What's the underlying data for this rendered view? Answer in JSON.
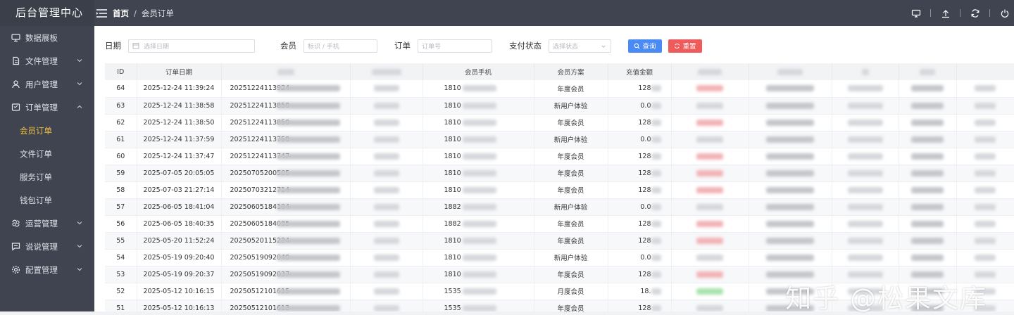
{
  "app": {
    "title": "后台管理中心"
  },
  "sidebar": {
    "items": [
      {
        "label": "数据展板",
        "icon": "monitor-icon"
      },
      {
        "label": "文件管理",
        "icon": "file-icon"
      },
      {
        "label": "用户管理",
        "icon": "user-icon"
      },
      {
        "label": "订单管理",
        "icon": "order-icon"
      },
      {
        "label": "运营管理",
        "icon": "operation-icon"
      },
      {
        "label": "说说管理",
        "icon": "chat-icon"
      },
      {
        "label": "配置管理",
        "icon": "gear-icon"
      }
    ],
    "submenu": [
      {
        "label": "会员订单",
        "active": true
      },
      {
        "label": "文件订单",
        "active": false
      },
      {
        "label": "服务订单",
        "active": false
      },
      {
        "label": "钱包订单",
        "active": false
      }
    ]
  },
  "header": {
    "breadcrumb": {
      "home": "首页",
      "separator": "/",
      "current": "会员订单"
    }
  },
  "filters": {
    "date": {
      "label": "日期",
      "placeholder": "选择日期"
    },
    "member": {
      "label": "会员",
      "placeholder": "标识 / 手机"
    },
    "order": {
      "label": "订单",
      "placeholder": "订单号"
    },
    "pay_status": {
      "label": "支付状态",
      "placeholder": "选择状态"
    },
    "search_label": "查询",
    "reset_label": "重置"
  },
  "table": {
    "headers": [
      "ID",
      "订单日期",
      "",
      "",
      "会员手机",
      "会员方案",
      "充值金额"
    ],
    "rows": [
      {
        "id": "64",
        "date": "2025-12-24 11:39:24",
        "order_no": "20251224113924",
        "phone": "1810",
        "plan": "年度会员",
        "amount": "128"
      },
      {
        "id": "63",
        "date": "2025-12-24 11:38:58",
        "order_no": "20251224113858",
        "phone": "1810",
        "plan": "新用户体验",
        "amount": "0.0"
      },
      {
        "id": "62",
        "date": "2025-12-24 11:38:50",
        "order_no": "20251224113850",
        "phone": "1810",
        "plan": "年度会员",
        "amount": "128"
      },
      {
        "id": "61",
        "date": "2025-12-24 11:37:59",
        "order_no": "20251224113759",
        "phone": "1810",
        "plan": "新用户体验",
        "amount": "0.0"
      },
      {
        "id": "60",
        "date": "2025-12-24 11:37:47",
        "order_no": "20251224113747",
        "phone": "1810",
        "plan": "年度会员",
        "amount": "128"
      },
      {
        "id": "59",
        "date": "2025-07-05 20:05:05",
        "order_no": "20250705200505",
        "phone": "1810",
        "plan": "年度会员",
        "amount": "128"
      },
      {
        "id": "58",
        "date": "2025-07-03 21:27:14",
        "order_no": "20250703212714",
        "phone": "1810",
        "plan": "年度会员",
        "amount": "128"
      },
      {
        "id": "57",
        "date": "2025-06-05 18:41:04",
        "order_no": "20250605184104",
        "phone": "1882",
        "plan": "新用户体验",
        "amount": "0.0"
      },
      {
        "id": "56",
        "date": "2025-06-05 18:40:35",
        "order_no": "20250605184035",
        "phone": "1882",
        "plan": "年度会员",
        "amount": "128"
      },
      {
        "id": "55",
        "date": "2025-05-20 11:52:24",
        "order_no": "20250520115224",
        "phone": "1810",
        "plan": "年度会员",
        "amount": "128"
      },
      {
        "id": "54",
        "date": "2025-05-19 09:20:40",
        "order_no": "20250519092040",
        "phone": "1810",
        "plan": "新用户体验",
        "amount": "0.0"
      },
      {
        "id": "53",
        "date": "2025-05-19 09:20:37",
        "order_no": "20250519092037",
        "phone": "1810",
        "plan": "年度会员",
        "amount": "128"
      },
      {
        "id": "52",
        "date": "2025-05-12 10:16:15",
        "order_no": "20250512101615",
        "phone": "1535",
        "plan": "月度会员",
        "amount": "18."
      },
      {
        "id": "51",
        "date": "2025-05-12 10:16:13",
        "order_no": "20250512101613",
        "phone": "1535",
        "plan": "年度会员",
        "amount": "128"
      }
    ]
  },
  "watermark": "知乎 @松果文库",
  "colors": {
    "sidebar_bg": "#3f4450",
    "active": "#f0c040",
    "primary": "#4a8af4",
    "danger": "#ef5a5a"
  }
}
